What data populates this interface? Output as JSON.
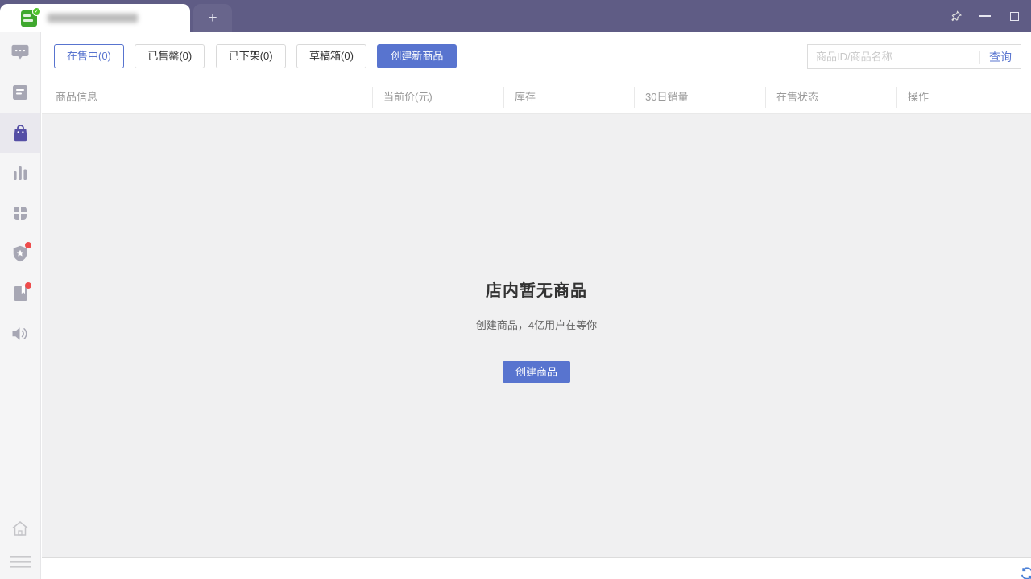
{
  "window": {
    "new_tab_label": "+"
  },
  "sidebar": {
    "items": [
      {
        "id": "chat",
        "icon": "chat-bubble-icon",
        "active": false,
        "badge": false
      },
      {
        "id": "orders",
        "icon": "document-list-icon",
        "active": false,
        "badge": false
      },
      {
        "id": "products",
        "icon": "shopping-bag-icon",
        "active": true,
        "badge": false
      },
      {
        "id": "analytics",
        "icon": "bar-chart-icon",
        "active": false,
        "badge": false
      },
      {
        "id": "apps",
        "icon": "app-grid-icon",
        "active": false,
        "badge": false
      },
      {
        "id": "protection",
        "icon": "shield-star-icon",
        "active": false,
        "badge": true
      },
      {
        "id": "resources",
        "icon": "book-icon",
        "active": false,
        "badge": true
      },
      {
        "id": "announcement",
        "icon": "speaker-icon",
        "active": false,
        "badge": false
      }
    ],
    "bottom_items": [
      {
        "id": "home",
        "icon": "home-icon"
      },
      {
        "id": "menu",
        "icon": "hamburger-icon"
      }
    ]
  },
  "toolbar": {
    "tabs": [
      {
        "label": "在售中(0)",
        "active": true
      },
      {
        "label": "已售罄(0)",
        "active": false
      },
      {
        "label": "已下架(0)",
        "active": false
      },
      {
        "label": "草稿箱(0)",
        "active": false
      }
    ],
    "create_new_label": "创建新商品",
    "search_placeholder": "商品ID/商品名称",
    "search_button": "查询"
  },
  "table": {
    "columns": [
      "商品信息",
      "当前价(元)",
      "库存",
      "30日销量",
      "在售状态",
      "操作"
    ]
  },
  "empty_state": {
    "title": "店内暂无商品",
    "subtitle": "创建商品，4亿用户在等你",
    "button": "创建商品"
  },
  "colors": {
    "accent_blue": "#5874cf",
    "titlebar_purple": "#5f5c85",
    "sidebar_active_purple": "#554fa5",
    "sidebar_icon_gray": "#a7a7b4",
    "badge_red": "#ee4c4c",
    "empty_panel_gray": "#f0f0f1",
    "store_avatar_green": "#3fa82e"
  }
}
